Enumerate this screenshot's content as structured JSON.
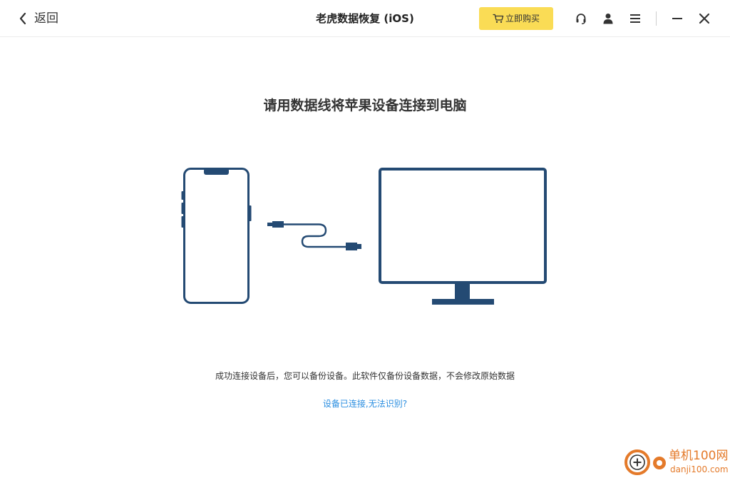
{
  "header": {
    "back_label": "返回",
    "app_title": "老虎数据恢复 (iOS)",
    "buy_label": "立即购买",
    "accent_color": "#fadc55",
    "icons": [
      "headset-icon",
      "user-icon",
      "menu-icon",
      "minimize-icon",
      "close-icon"
    ]
  },
  "main": {
    "headline": "请用数据线将苹果设备连接到电脑",
    "illustration": {
      "stroke_color": "#244a73",
      "items": [
        "phone-icon",
        "cable-icon",
        "monitor-icon"
      ]
    },
    "hint": "成功连接设备后，您可以备份设备。此软件仅备份设备数据，不会修改原始数据",
    "help_link": "设备已连接,无法识别?",
    "link_color": "#2a8ee0"
  },
  "watermark": {
    "brand": "单机100网",
    "url": "danji100.com",
    "color": "#e47a2a"
  }
}
